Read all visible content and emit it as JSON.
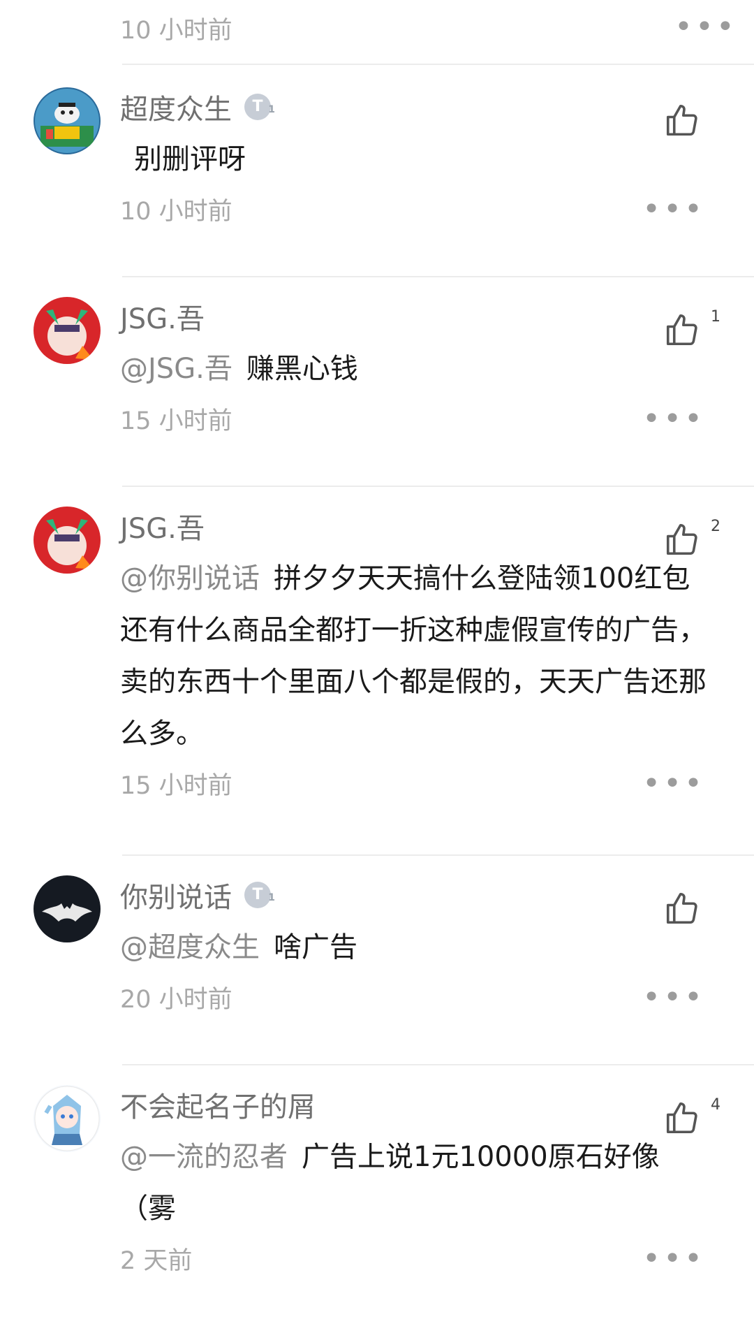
{
  "top_partial": {
    "time": "10 小时前"
  },
  "comments": [
    {
      "name": "超度众生",
      "badge": true,
      "like_count": "",
      "mention": "",
      "text": "别删评呀",
      "time": "10 小时前"
    },
    {
      "name": "JSG.吾",
      "badge": false,
      "like_count": "1",
      "mention": "@JSG.吾",
      "text": "赚黑心钱",
      "time": "15 小时前"
    },
    {
      "name": "JSG.吾",
      "badge": false,
      "like_count": "2",
      "mention": "@你别说话",
      "text": "拼夕夕天天搞什么登陆领100红包还有什么商品全都打一折这种虚假宣传的广告，卖的东西十个里面八个都是假的，天天广告还那么多。",
      "time": "15 小时前"
    },
    {
      "name": "你别说话",
      "badge": true,
      "like_count": "",
      "mention": "@超度众生",
      "text": "啥广告",
      "time": "20 小时前"
    },
    {
      "name": "不会起名子的屑",
      "badge": false,
      "like_count": "4",
      "mention": "@一流的忍者",
      "text": "广告上说1元10000原石好像（雾",
      "time": "2 天前"
    }
  ],
  "icons": {
    "like": "thumbs-up-icon",
    "more": "more-dots-icon",
    "badge": "level-badge-icon"
  },
  "colors": {
    "name": "#707070",
    "text": "#1a1a1a",
    "mention": "#8a8a8a",
    "time": "#a8a8a8",
    "divider": "#ececec"
  },
  "more_glyph": "•••"
}
